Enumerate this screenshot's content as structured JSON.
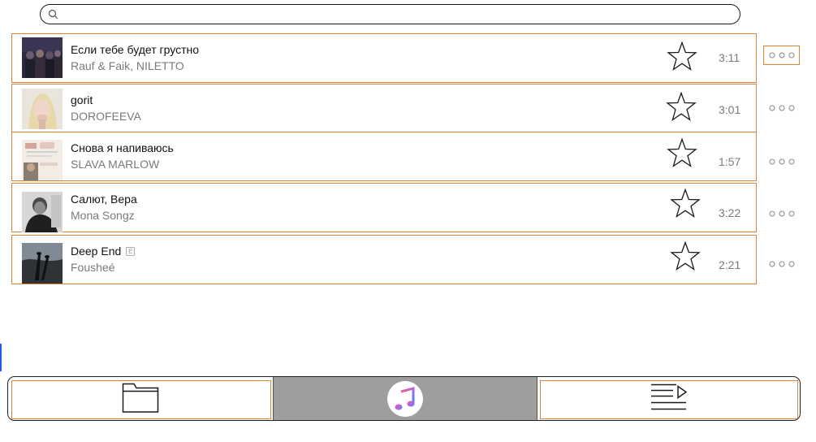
{
  "search": {
    "placeholder": "",
    "value": ""
  },
  "tracks": [
    {
      "title": "Если тебе будет грустно",
      "artist": "Rauf & Faik, NILETTO",
      "duration": "3:11",
      "explicit": false,
      "favorite": false,
      "more_active": true
    },
    {
      "title": "gorit",
      "artist": "DOROFEEVA",
      "duration": "3:01",
      "explicit": false,
      "favorite": false,
      "more_active": false
    },
    {
      "title": "Снова я напиваюсь",
      "artist": "SLAVA MARLOW",
      "duration": "1:57",
      "explicit": false,
      "favorite": false,
      "more_active": false
    },
    {
      "title": "Салют, Вера",
      "artist": "Mona Songz",
      "duration": "3:22",
      "explicit": false,
      "favorite": false,
      "more_active": false
    },
    {
      "title": "Deep End",
      "artist": "Fousheé",
      "duration": "2:21",
      "explicit": true,
      "explicit_label": "E",
      "favorite": false,
      "more_active": false
    }
  ],
  "bottom_nav": {
    "tabs": [
      {
        "id": "files",
        "icon": "folder-icon",
        "active": false
      },
      {
        "id": "music",
        "icon": "music-note-icon",
        "active": true
      },
      {
        "id": "queue",
        "icon": "playlist-play-icon",
        "active": false
      }
    ]
  },
  "colors": {
    "row_border": "#d9843a",
    "active_tab_bg": "#9e9e9e",
    "secondary_text": "#7a7a7a"
  }
}
